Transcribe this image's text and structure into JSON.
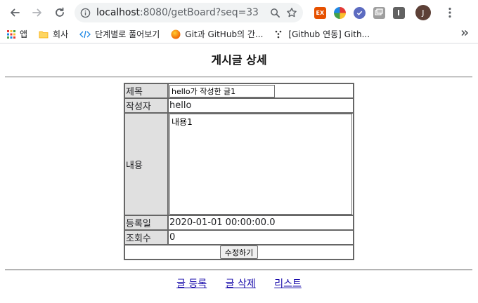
{
  "browser": {
    "url_host": "localhost",
    "url_rest": ":8080/getBoard?seq=33",
    "profile_initial": "J",
    "extension_ex_label": "EX"
  },
  "bookmarks": [
    {
      "label": "앱",
      "icon": "apps-grid-icon"
    },
    {
      "label": "회사",
      "icon": "folder-icon"
    },
    {
      "label": "단계별로 풀어보기",
      "icon": "code-icon"
    },
    {
      "label": "Git과 GitHub의 간...",
      "icon": "orange-circle-icon"
    },
    {
      "label": "[Github 연동] Gith...",
      "icon": "github-dots-icon"
    }
  ],
  "page": {
    "title": "게시글 상세",
    "labels": {
      "title": "제목",
      "writer": "작성자",
      "content": "내용",
      "regdate": "등록일",
      "cnt": "조회수"
    },
    "values": {
      "title": "hello가 작성한 글1",
      "writer": "hello",
      "content": "내용1",
      "regdate": "2020-01-01 00:00:00.0",
      "cnt": "0"
    },
    "submit_label": "수정하기",
    "links": {
      "insert": "글 등록",
      "delete": "글 삭제",
      "list": "리스트"
    }
  },
  "colors": {
    "label_bg": "#e0e0e0",
    "link": "#1a0dab",
    "avatar": "#5d4037"
  }
}
